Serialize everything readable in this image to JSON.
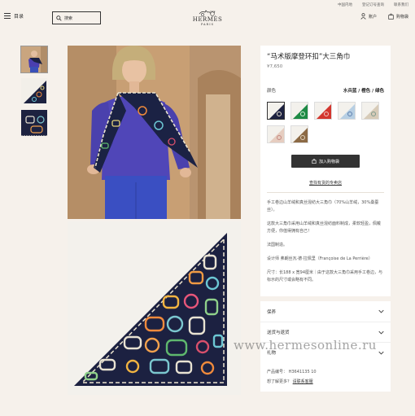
{
  "header": {
    "util_links": [
      "中国内地",
      "登记订号查询",
      "联系我们"
    ],
    "menu_label": "目录",
    "search_placeholder": "搜索",
    "brand": "HERMÈS",
    "city": "PARIS",
    "account_label": "账户",
    "cart_label": "购物袋"
  },
  "product": {
    "title": "“马术版摩登环扣”大三角巾",
    "price": "¥7,650",
    "color_label": "颜色",
    "color_name": "水兵蓝 / 橙色 / 绿色",
    "swatches": [
      {
        "name": "swatch-navy",
        "bg": "#1d2240",
        "accent": "#e8e2d2"
      },
      {
        "name": "swatch-green",
        "bg": "#1e8a45",
        "accent": "#d7eed9"
      },
      {
        "name": "swatch-red",
        "bg": "#d3362e",
        "accent": "#f2c7c2"
      },
      {
        "name": "swatch-sky",
        "bg": "#b7cfe3",
        "accent": "#5d7fae"
      },
      {
        "name": "swatch-beige",
        "bg": "#d7cbb8",
        "accent": "#7e9a8d"
      },
      {
        "name": "swatch-blush",
        "bg": "#e6cdc0",
        "accent": "#c48880"
      },
      {
        "name": "swatch-brown",
        "bg": "#8c6a45",
        "accent": "#e0d3bd"
      }
    ],
    "add_to_cart": "加入购物袋",
    "expert_link": "查找有货的专卖店",
    "desc": [
      "手工卷边山羊绒和真丝混纺大三角巾（70%山羊绒，30%桑蚕丝）。",
      "这款大三角巾采用山羊绒和真丝混纺面料制成，柔软轻盈，佩戴方便，你值得拥有自己！",
      "法国制造。",
      "设计师 弗朗丝瓦·德·拉佩里（Françoise de La Perrière）",
      "尺寸：长188 x 宽94厘米｜由于这款大三角巾采用手工卷边，与标示的尺寸或会略有不同。"
    ],
    "accordion": [
      "保养",
      "送货与退货",
      "礼物"
    ],
    "sku_label": "产品编号：",
    "sku": "H3641135 10",
    "more_q": "想了解更多？",
    "more_link": "请联系客服"
  },
  "watermark": "www.hermesonline.ru",
  "colors": {
    "accent": "#333333",
    "bg": "#f6f1eb",
    "card": "#ffffff"
  }
}
